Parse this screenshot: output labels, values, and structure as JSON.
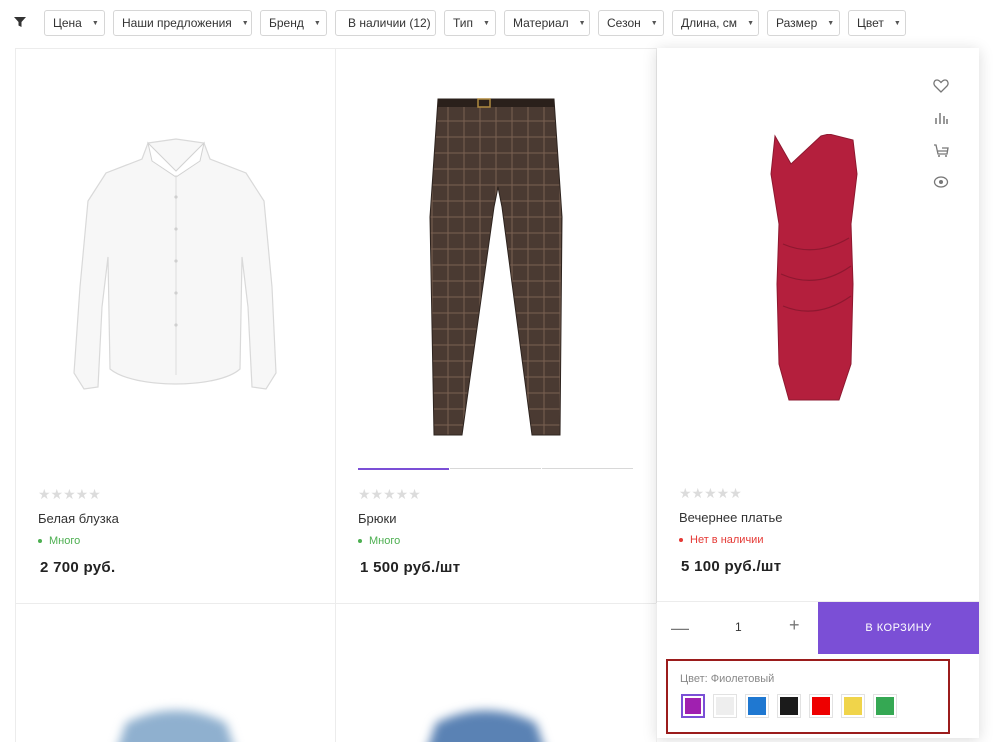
{
  "filters": [
    {
      "label": "Цена"
    },
    {
      "label": "Наши предложения"
    },
    {
      "label": "Бренд"
    },
    {
      "label": "В наличии (12)"
    },
    {
      "label": "Тип"
    },
    {
      "label": "Материал"
    },
    {
      "label": "Сезон"
    },
    {
      "label": "Длина, см"
    },
    {
      "label": "Размер"
    },
    {
      "label": "Цвет"
    }
  ],
  "filter_icon": "funnel-icon",
  "rating_stars": "★★★★★",
  "products": [
    {
      "name": "Белая блузка",
      "stock": "Много",
      "stock_color": "#4caf50",
      "price": "2 700 руб."
    },
    {
      "name": "Брюки",
      "stock": "Много",
      "stock_color": "#4caf50",
      "price": "1 500 руб./шт"
    },
    {
      "name": "Вечернее платье",
      "stock": "Нет в наличии",
      "stock_color": "#e53935",
      "price": "5 100 руб./шт"
    }
  ],
  "side_icons": [
    "heart-icon",
    "compare-icon",
    "cart-icon",
    "eye-icon"
  ],
  "buy_bar": {
    "minus": "—",
    "quantity": "1",
    "plus": "+",
    "cart_label": "В КОРЗИНУ"
  },
  "color_picker": {
    "label": "Цвет: Фиолетовый",
    "swatches": [
      "#a020b0",
      "#eeeeee",
      "#1f78d1",
      "#1b1b1b",
      "#ee0000",
      "#f0d44a",
      "#35a853"
    ]
  },
  "colors": {
    "accent": "#7b4fd6",
    "highlight_border": "#9b1c1c"
  }
}
